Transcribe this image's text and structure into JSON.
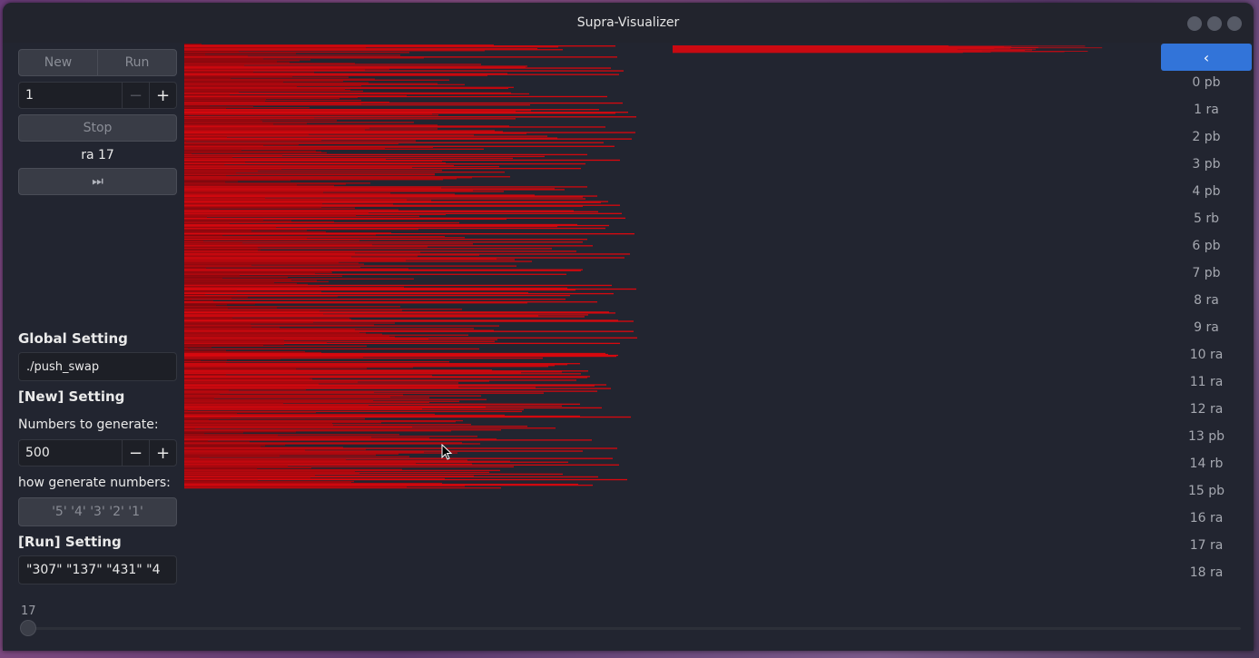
{
  "window": {
    "title": "Supra-Visualizer"
  },
  "toolbar": {
    "new_label": "New",
    "run_label": "Run"
  },
  "step_spinner": {
    "value": "1",
    "minus": "−",
    "plus": "+"
  },
  "stop_label": "Stop",
  "current_op": "ra 17",
  "skip_end_icon": "⏭",
  "global_setting": {
    "heading": "Global Setting",
    "path_value": "./push_swap"
  },
  "new_setting": {
    "heading": "[New] Setting",
    "numbers_label": "Numbers to generate:",
    "numbers_value": "500",
    "minus": "−",
    "plus": "+",
    "method_label": "how generate numbers:",
    "method_value": "'5' '4' '3' '2' '1'"
  },
  "run_setting": {
    "heading": "[Run] Setting",
    "args_value": "\"307\" \"137\" \"431\" \"4"
  },
  "ops_list": {
    "back_icon": "‹",
    "items": [
      "0 pb",
      "1 ra",
      "2 pb",
      "3 pb",
      "4 pb",
      "5 rb",
      "6 pb",
      "7 pb",
      "8 ra",
      "9 ra",
      "10 ra",
      "11 ra",
      "12 ra",
      "13 pb",
      "14 rb",
      "15 pb",
      "16 ra",
      "17 ra",
      "18 ra"
    ]
  },
  "slider": {
    "value": "17",
    "position_fraction": 0.0
  },
  "colors": {
    "bar": "#cc0a12",
    "accent": "#3274d9",
    "background": "#222530"
  },
  "stacks": {
    "stack_a_count": 483,
    "stack_b_count": 17
  }
}
